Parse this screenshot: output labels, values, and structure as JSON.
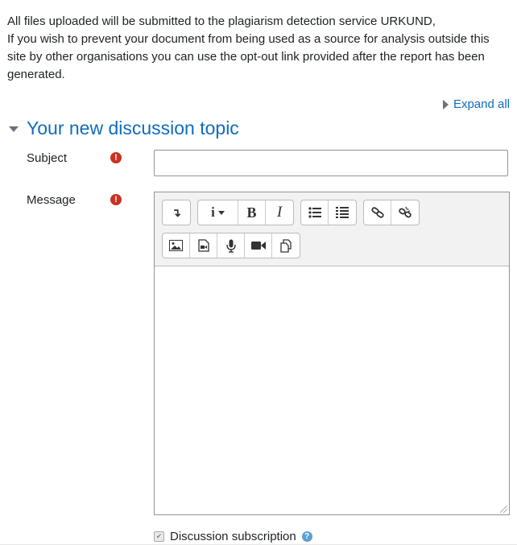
{
  "notice": {
    "line1": "All files uploaded will be submitted to the plagiarism detection service URKUND,",
    "line2": "If you wish to prevent your document from being used as a source for analysis outside this site by other organisations you can use the opt-out link provided after the report has been generated."
  },
  "expand_all": "Expand all",
  "section": {
    "title": "Your new discussion topic"
  },
  "fields": {
    "subject_label": "Subject",
    "message_label": "Message",
    "required_glyph": "!"
  },
  "subscription": {
    "label": "Discussion subscription",
    "checked": true,
    "help_glyph": "?"
  },
  "toolbar": {
    "row1": [
      [
        "toolbar-toggle-icon"
      ],
      [
        "paragraph-styles-icon",
        "bold-icon",
        "italic-icon"
      ],
      [
        "unordered-list-icon",
        "ordered-list-icon"
      ],
      [
        "link-icon",
        "unlink-icon"
      ]
    ],
    "row2": [
      [
        "image-icon",
        "media-icon",
        "record-audio-icon",
        "record-video-icon",
        "manage-files-icon"
      ]
    ],
    "glyphs": {
      "toggle": "↴",
      "info": "i",
      "bold": "B",
      "italic": "I"
    }
  },
  "colors": {
    "link": "#0f6cbf",
    "required": "#ca3120",
    "help": "#5a9fd6",
    "text": "#1d2125"
  }
}
